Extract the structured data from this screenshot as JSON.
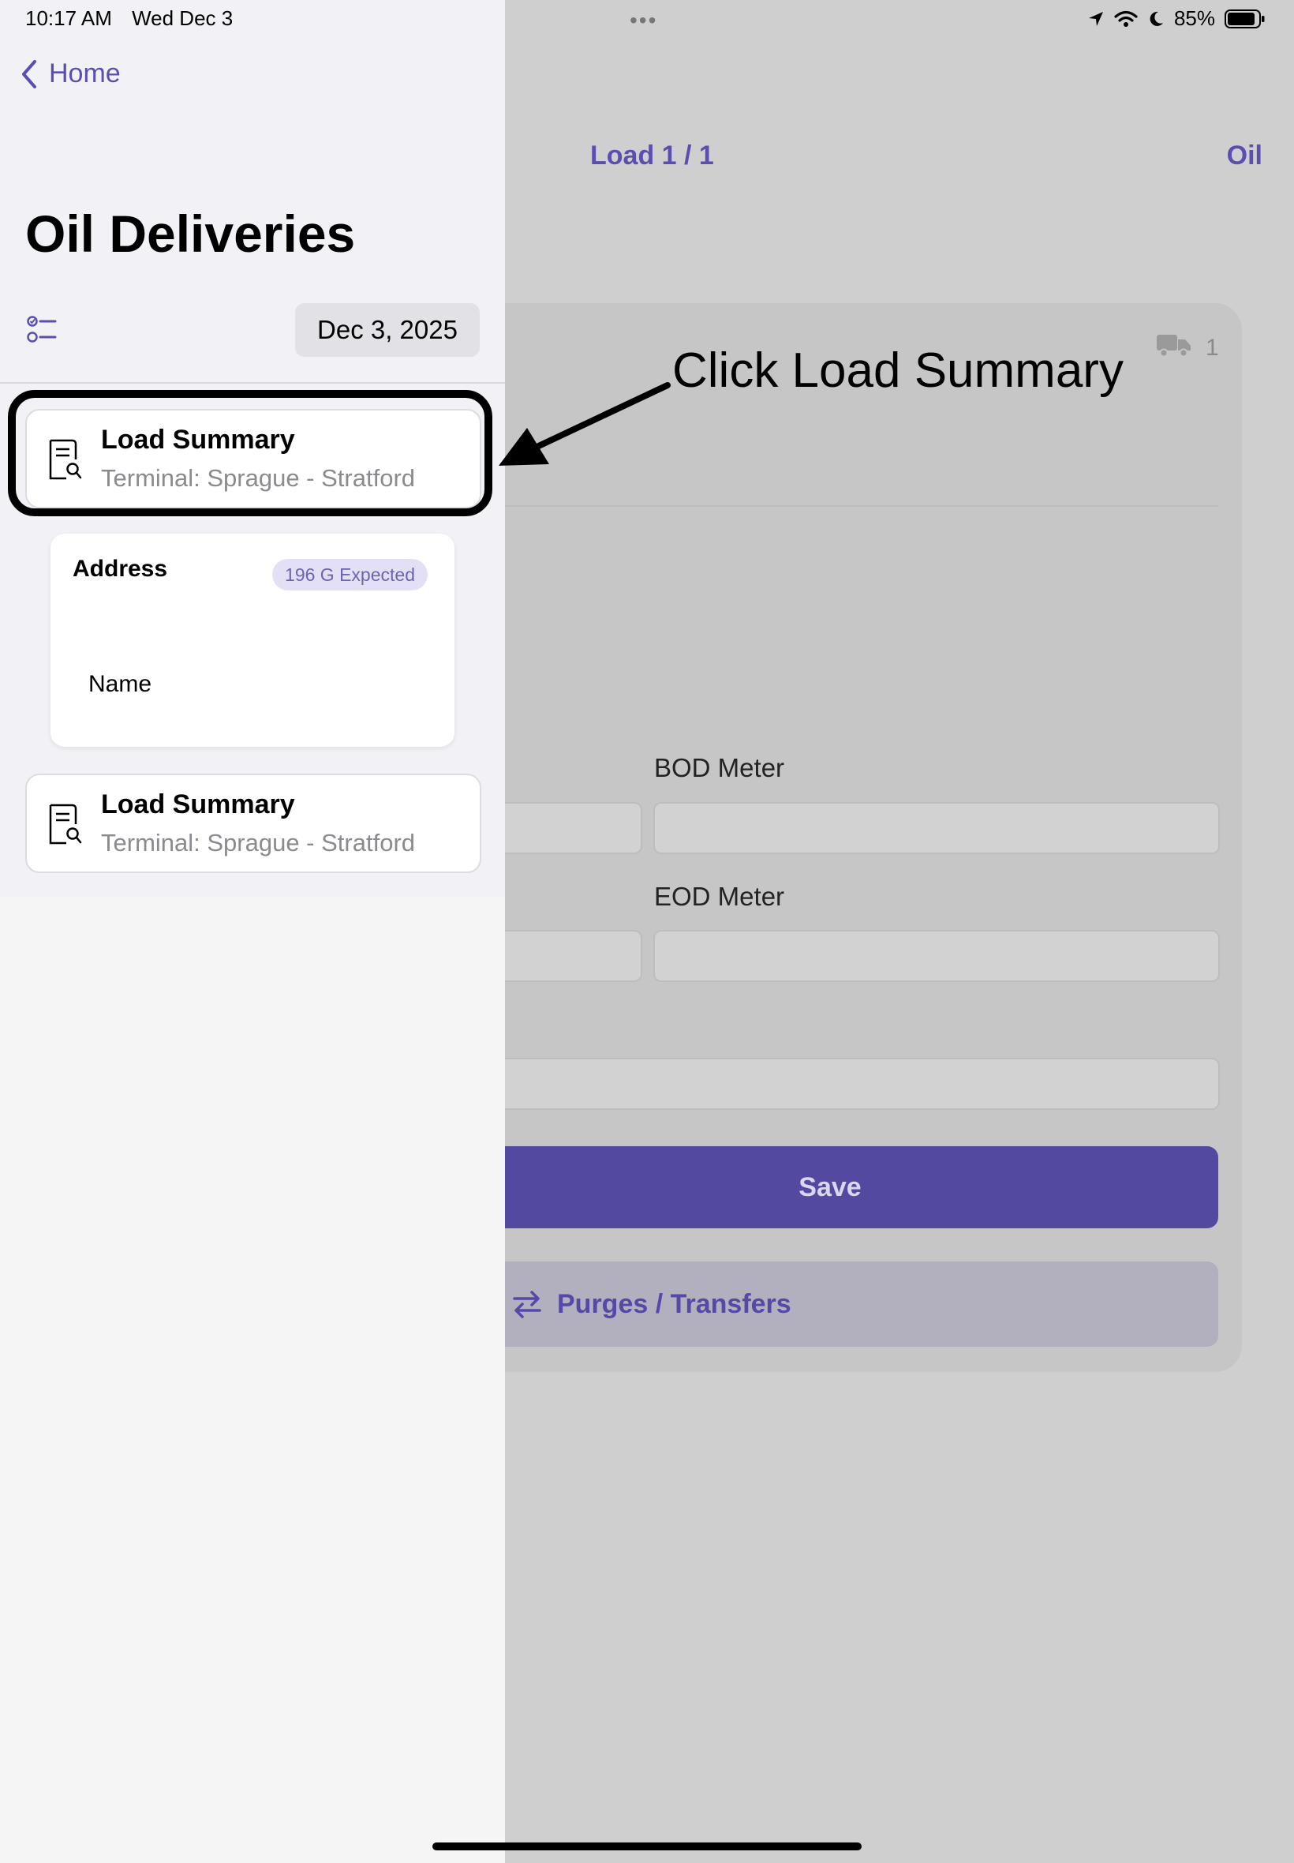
{
  "status_bar": {
    "time": "10:17 AM",
    "date": "Wed Dec 3",
    "battery": "85%"
  },
  "sidebar": {
    "back_label": "Home",
    "title": "Oil Deliveries",
    "date": "Dec 3, 2025",
    "rows": [
      {
        "title": "Load Summary",
        "subtitle": "Terminal: Sprague - Stratford"
      },
      {
        "title": "Load Summary",
        "subtitle": "Terminal: Sprague - Stratford"
      }
    ],
    "address_card": {
      "title": "Address",
      "badge": "196 G Expected",
      "name": "Name"
    }
  },
  "detail": {
    "nav_title": "Load 1 / 1",
    "nav_right": "Oil",
    "truck_count": "1",
    "bod_label": "BOD Meter",
    "eod_label": "EOD Meter",
    "save_label": "Save",
    "purge_label": "Purges / Transfers"
  },
  "annotation": {
    "text": "Click Load Summary"
  },
  "colors": {
    "accent": "#5a4fb0",
    "save_button": "#5449a1"
  }
}
